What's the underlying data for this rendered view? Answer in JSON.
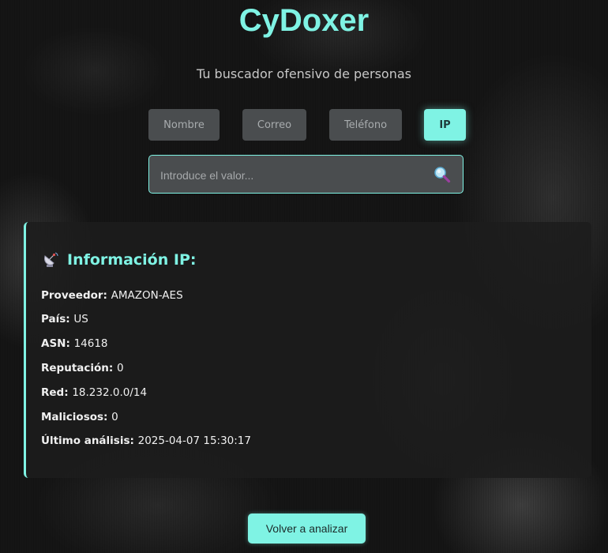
{
  "app": {
    "title": "CyDoxer",
    "subtitle": "Tu buscador ofensivo de personas"
  },
  "tabs": [
    {
      "label": "Nombre",
      "active": false
    },
    {
      "label": "Correo",
      "active": false
    },
    {
      "label": "Teléfono",
      "active": false
    },
    {
      "label": "IP",
      "active": true
    }
  ],
  "search": {
    "placeholder": "Introduce el valor...",
    "value": "",
    "icon": "magnifier-icon"
  },
  "result": {
    "icon": "satellite-dish-icon",
    "title": "Información IP:",
    "fields": [
      {
        "key": "Proveedor:",
        "value": "AMAZON-AES"
      },
      {
        "key": "País:",
        "value": "US"
      },
      {
        "key": "ASN:",
        "value": "14618"
      },
      {
        "key": "Reputación:",
        "value": "0"
      },
      {
        "key": "Red:",
        "value": "18.232.0.0/14"
      },
      {
        "key": "Maliciosos:",
        "value": "0"
      },
      {
        "key": "Último análisis:",
        "value": "2025-04-07 15:30:17"
      }
    ]
  },
  "actions": {
    "reanalyze_label": "Volver a analizar"
  },
  "colors": {
    "accent": "#7ff3e4",
    "tab_bg": "#4a4d4f",
    "card_bg": "#1c1c1c"
  }
}
